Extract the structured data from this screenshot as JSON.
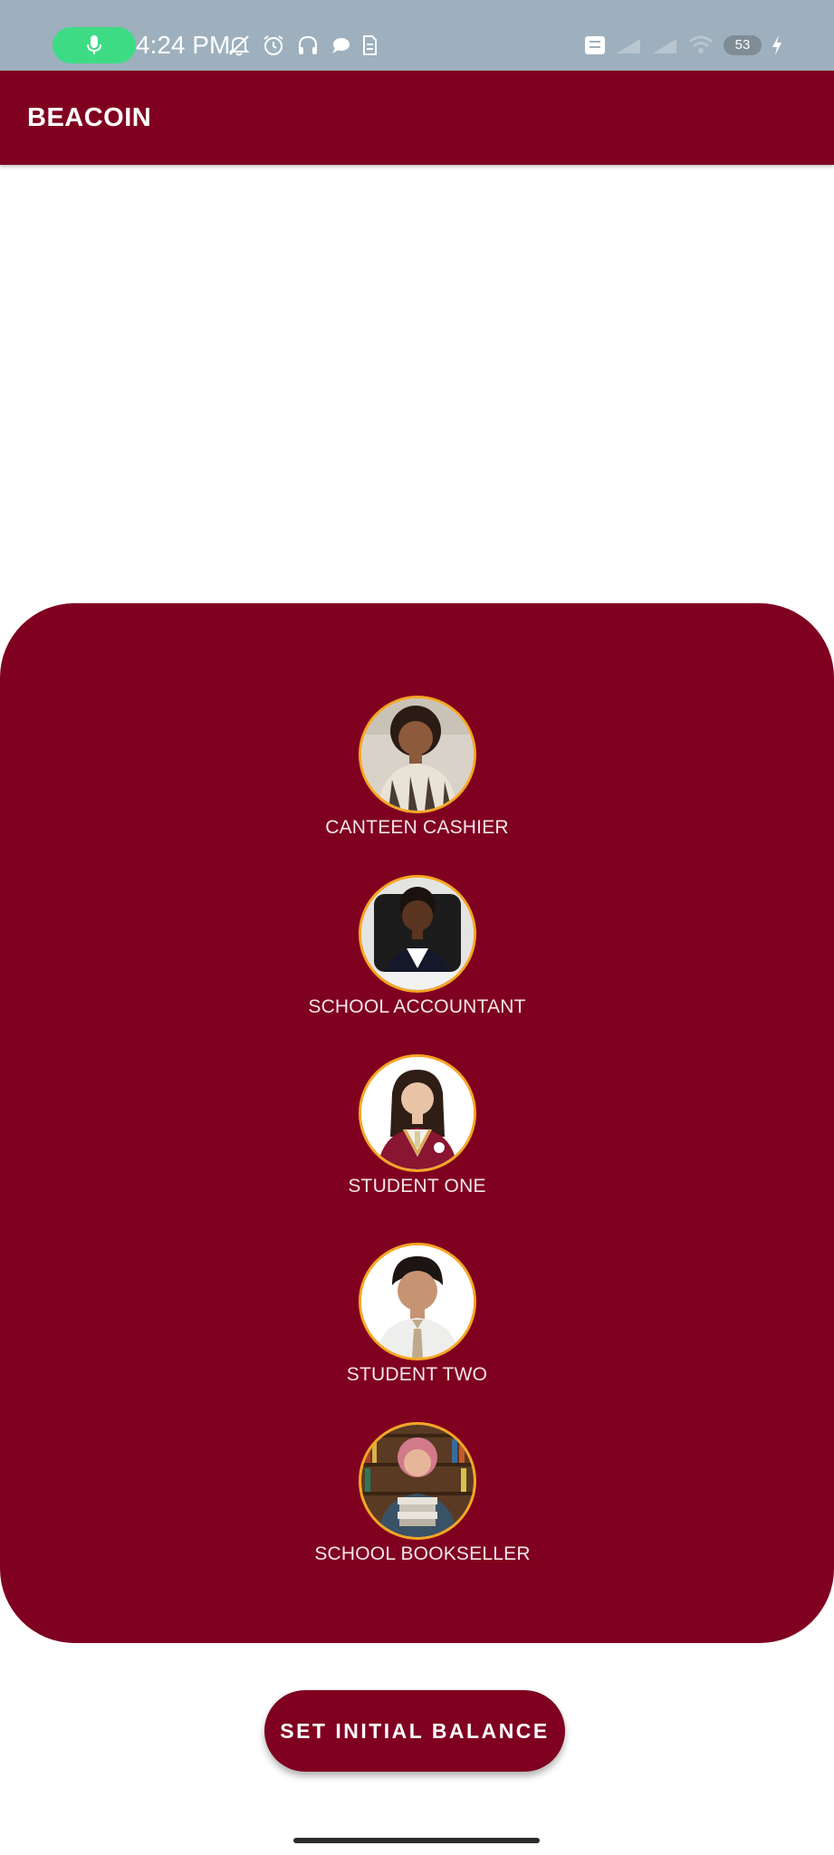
{
  "status_bar": {
    "time": "4:24 PM",
    "battery": "53",
    "icons_left": [
      "microphone-icon",
      "bell-muted-icon",
      "alarm-icon",
      "headset-icon",
      "chat-icon",
      "sim-icon"
    ],
    "icons_right": [
      "volte-icon",
      "signal-icon",
      "signal-icon",
      "wifi-icon",
      "battery-icon",
      "charging-icon"
    ]
  },
  "app_bar": {
    "title": "BEACOIN"
  },
  "profiles": [
    {
      "label": "CANTEEN CASHIER"
    },
    {
      "label": "SCHOOL ACCOUNTANT"
    },
    {
      "label": "STUDENT ONE"
    },
    {
      "label": "STUDENT TWO"
    },
    {
      "label": "SCHOOL BOOKSELLER"
    }
  ],
  "action": {
    "label": "SET INITIAL BALANCE"
  },
  "colors": {
    "primary": "#800020",
    "avatar_ring": "#f5a623",
    "status_bar": "#9eb0bd",
    "mic_pill": "#3ddc84"
  }
}
